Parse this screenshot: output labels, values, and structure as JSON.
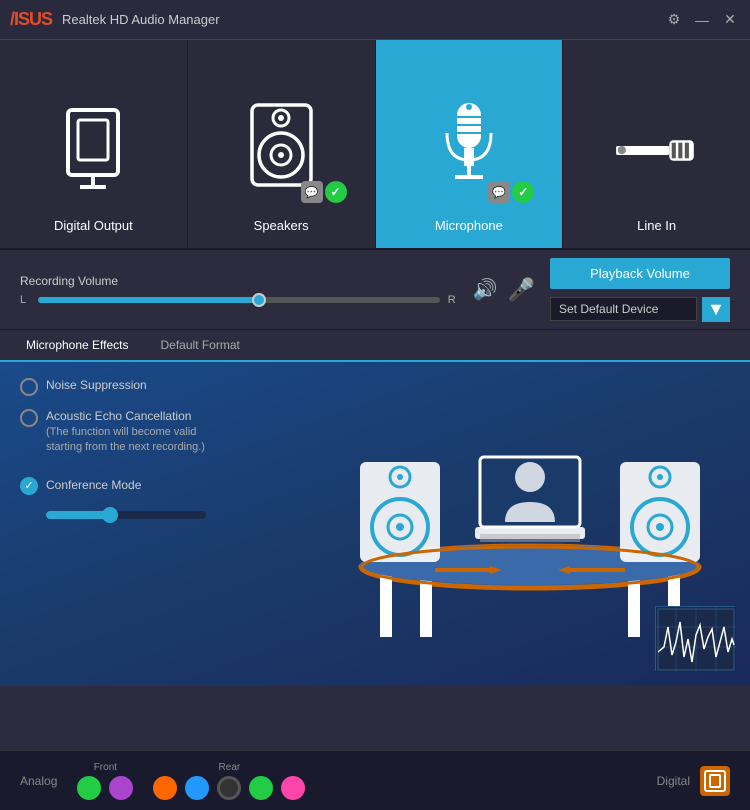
{
  "titleBar": {
    "logo": "/ISUS",
    "title": "Realtek HD Audio Manager",
    "settingsBtn": "⚙",
    "minimizeBtn": "—",
    "closeBtn": "✕"
  },
  "deviceTabs": [
    {
      "id": "digital-output",
      "label": "Digital Output",
      "active": false,
      "hasBadge": false
    },
    {
      "id": "speakers",
      "label": "Speakers",
      "active": false,
      "hasBadge": true
    },
    {
      "id": "microphone",
      "label": "Microphone",
      "active": true,
      "hasBadge": true
    },
    {
      "id": "line-in",
      "label": "Line In",
      "active": false,
      "hasBadge": false
    }
  ],
  "volume": {
    "recordingLabel": "Recording Volume",
    "lLabel": "L",
    "rLabel": "R",
    "sliderValue": 55,
    "playbackBtn": "Playback Volume",
    "defaultDeviceLabel": "Set Default Device"
  },
  "effectTabs": [
    {
      "id": "mic-effects",
      "label": "Microphone Effects",
      "active": true
    },
    {
      "id": "default-format",
      "label": "Default Format",
      "active": false
    }
  ],
  "effects": [
    {
      "id": "noise-suppression",
      "label": "Noise Suppression",
      "subText": "",
      "checked": false
    },
    {
      "id": "acoustic-echo",
      "label": "Acoustic Echo Cancellation",
      "subText": "(The function will become valid\nstarting from the next recording.)",
      "checked": false
    },
    {
      "id": "conference-mode",
      "label": "Conference Mode",
      "subText": "",
      "checked": true,
      "hasSlider": true,
      "sliderValue": 40
    }
  ],
  "bottomBar": {
    "analogLabel": "Analog",
    "frontLabel": "Front",
    "rearLabel": "Rear",
    "digitalLabel": "Digital",
    "frontPorts": [
      {
        "color": "green",
        "id": "front-green"
      },
      {
        "color": "purple",
        "id": "front-purple"
      }
    ],
    "rearPorts": [
      {
        "color": "orange",
        "id": "rear-orange"
      },
      {
        "color": "blue",
        "id": "rear-blue"
      },
      {
        "color": "dark",
        "id": "rear-dark"
      },
      {
        "color": "green2",
        "id": "rear-green"
      },
      {
        "color": "pink",
        "id": "rear-pink"
      }
    ]
  }
}
